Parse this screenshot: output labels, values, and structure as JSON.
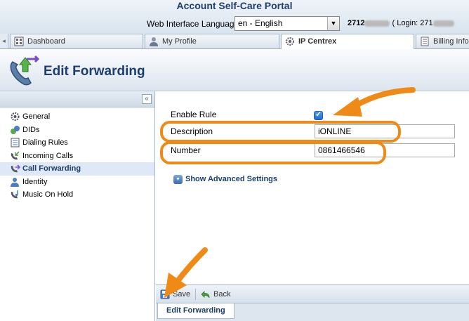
{
  "header": {
    "portal_title": "Account Self-Care Portal",
    "language_label": "Web Interface Language:",
    "language_value": "en - English",
    "account_number": "2712",
    "login_label": "( Login: 271"
  },
  "tabs": [
    {
      "label": "Dashboard"
    },
    {
      "label": "My Profile"
    },
    {
      "label": "IP Centrex"
    },
    {
      "label": "Billing Info"
    }
  ],
  "page": {
    "title": "Edit Forwarding"
  },
  "sidebar": {
    "collapse_glyph": "«",
    "items": [
      {
        "label": "General"
      },
      {
        "label": "DIDs"
      },
      {
        "label": "Dialing Rules"
      },
      {
        "label": "Incoming Calls"
      },
      {
        "label": "Call Forwarding"
      },
      {
        "label": "Identity"
      },
      {
        "label": "Music On Hold"
      }
    ]
  },
  "form": {
    "enable_rule_label": "Enable Rule",
    "enable_rule_checked": true,
    "description_label": "Description",
    "description_value": "iONLINE",
    "number_label": "Number",
    "number_value": "0861466546",
    "advanced_label": "Show Advanced Settings"
  },
  "toolbar": {
    "save_label": "Save",
    "back_label": "Back"
  },
  "bottom_tab": {
    "label": "Edit Forwarding"
  },
  "colors": {
    "annotation": "#f08a16",
    "title": "#1c3e6e",
    "checkbox": "#1e6fd6"
  }
}
